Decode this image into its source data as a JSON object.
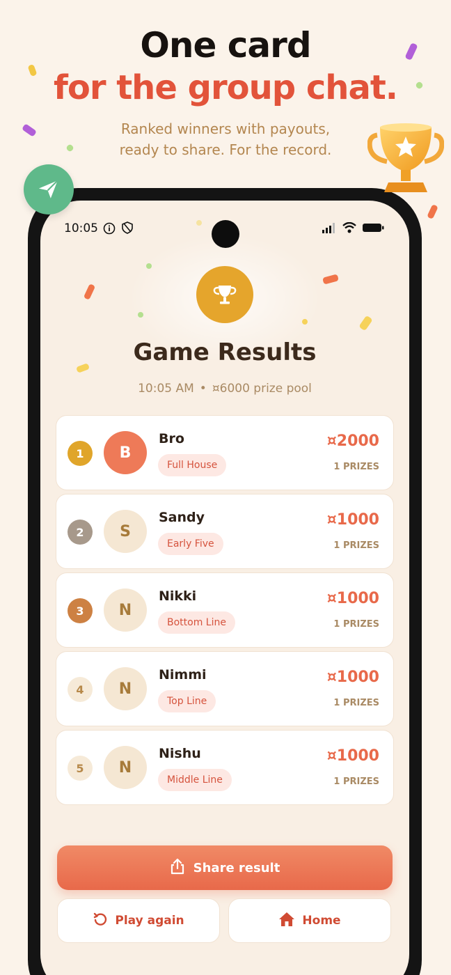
{
  "promo": {
    "title_line1": "One card",
    "title_line2": "for the group chat.",
    "subtitle_line1": "Ranked winners with payouts,",
    "subtitle_line2": "ready to share. For the record."
  },
  "status_bar": {
    "time": "10:05"
  },
  "results": {
    "title": "Game Results",
    "time": "10:05 AM",
    "separator": "•",
    "prize_pool": "¤6000 prize pool"
  },
  "winners": [
    {
      "rank": "1",
      "initial": "B",
      "name": "Bro",
      "prize": "Full House",
      "amount": "¤2000",
      "count": "1 PRIZES",
      "rank_bg": "#e0a52a",
      "rank_fg": "#ffffff",
      "avatar_bg": "#ee7a58",
      "avatar_fg": "#ffffff"
    },
    {
      "rank": "2",
      "initial": "S",
      "name": "Sandy",
      "prize": "Early Five",
      "amount": "¤1000",
      "count": "1 PRIZES",
      "rank_bg": "#a7998b",
      "rank_fg": "#ffffff",
      "avatar_bg": "#f5e7d3",
      "avatar_fg": "#a77b3a"
    },
    {
      "rank": "3",
      "initial": "N",
      "name": "Nikki",
      "prize": "Bottom Line",
      "amount": "¤1000",
      "count": "1 PRIZES",
      "rank_bg": "#cd8143",
      "rank_fg": "#ffffff",
      "avatar_bg": "#f5e7d3",
      "avatar_fg": "#a77b3a"
    },
    {
      "rank": "4",
      "initial": "N",
      "name": "Nimmi",
      "prize": "Top Line",
      "amount": "¤1000",
      "count": "1 PRIZES",
      "rank_bg": "#f6ead8",
      "rank_fg": "#b7894a",
      "avatar_bg": "#f5e7d3",
      "avatar_fg": "#a77b3a"
    },
    {
      "rank": "5",
      "initial": "N",
      "name": "Nishu",
      "prize": "Middle Line",
      "amount": "¤1000",
      "count": "1 PRIZES",
      "rank_bg": "#f6ead8",
      "rank_fg": "#b7894a",
      "avatar_bg": "#f5e7d3",
      "avatar_fg": "#a77b3a"
    }
  ],
  "actions": {
    "share_label": "Share result",
    "play_again_label": "Play again",
    "home_label": "Home"
  },
  "icons": {
    "send": "send-icon",
    "trophy": "trophy-icon",
    "share": "share-icon",
    "replay": "replay-icon",
    "home": "home-icon"
  },
  "colors": {
    "accent": "#e8694a",
    "title_red": "#e2533a",
    "gold": "#e5a52c",
    "background": "#fbf3ea"
  }
}
